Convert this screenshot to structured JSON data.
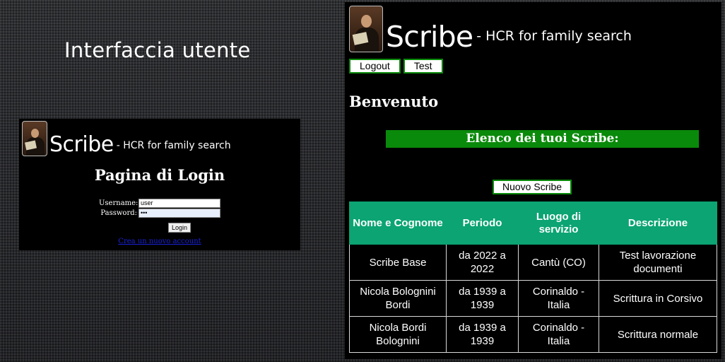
{
  "slide": {
    "title": "Interfaccia utente"
  },
  "login_screen": {
    "brand": {
      "name": "Scribe",
      "subtitle": "- HCR for family search"
    },
    "heading": "Pagina di Login",
    "username": {
      "label": "Username:",
      "value": "user"
    },
    "password": {
      "label": "Password:",
      "value": "•••"
    },
    "login_button": "Login",
    "register_link": "Crea un nuovo account"
  },
  "main_screen": {
    "brand": {
      "name": "Scribe",
      "subtitle": "- HCR for family search"
    },
    "nav": {
      "logout": "Logout",
      "test": "Test"
    },
    "welcome": "Benvenuto",
    "list_title": "Elenco dei tuoi Scribe:",
    "new_button": "Nuovo Scribe",
    "table": {
      "headers": [
        "Nome e Cognome",
        "Periodo",
        "Luogo di servizio",
        "Descrizione"
      ],
      "rows": [
        [
          "Scribe Base",
          "da 2022 a 2022",
          "Cantù (CO)",
          "Test lavorazione documenti"
        ],
        [
          "Nicola Bolognini Bordi",
          "da 1939 a 1939",
          "Corinaldo - Italia",
          "Scrittura in Corsivo"
        ],
        [
          "Nicola Bordi Bolognini",
          "da 1939 a 1939",
          "Corinaldo - Italia",
          "Scrittura normale"
        ]
      ]
    },
    "colors": {
      "accent_green": "#0a8a0a",
      "header_green": "#0ba472"
    }
  }
}
